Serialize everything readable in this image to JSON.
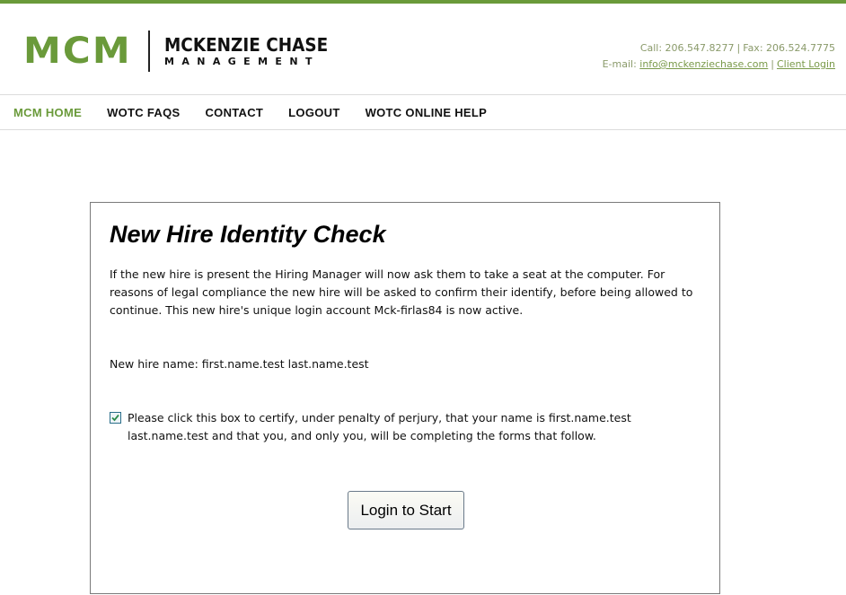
{
  "brand": {
    "logo_short": "MCM",
    "logo_name": "MCKENZIE CHASE",
    "logo_sub": "MANAGEMENT",
    "accent_color": "#6a9a3a"
  },
  "contact": {
    "call_label": "Call: 206.547.8277",
    "fax_label": "Fax: 206.524.7775",
    "email_label": "E-mail:",
    "email_link": "info@mckenziechase.com",
    "client_login": "Client Login",
    "separator": "|"
  },
  "nav": {
    "items": [
      {
        "label": "MCM HOME",
        "active": true
      },
      {
        "label": "WOTC FAQS"
      },
      {
        "label": "CONTACT"
      },
      {
        "label": "LOGOUT"
      },
      {
        "label": "WOTC ONLINE HELP"
      }
    ]
  },
  "panel": {
    "title": "New Hire Identity Check",
    "intro": "If the new hire is present the Hiring Manager will now ask them to take a seat at the computer. For reasons of legal compliance the new hire will be asked to confirm their identify, before being allowed to continue. This new hire's unique login account Mck-firlas84 is now active.",
    "hire_name": "New hire name: first.name.test last.name.test",
    "certify_checked": true,
    "certify_text": "Please click this box to certify, under penalty of perjury, that your name is first.name.test last.name.test and that you, and only you, will be completing the forms that follow.",
    "login_button": "Login to Start"
  }
}
